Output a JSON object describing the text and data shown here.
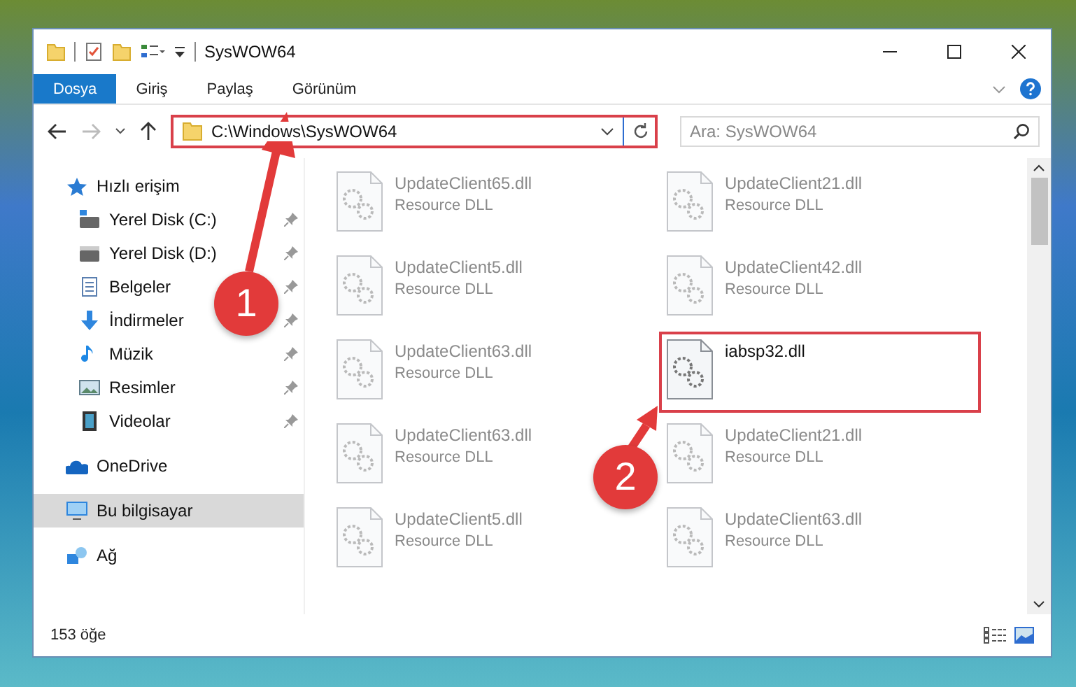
{
  "window": {
    "title": "SysWOW64"
  },
  "ribbon_tabs": [
    {
      "label": "Dosya",
      "selected": true
    },
    {
      "label": "Giriş",
      "selected": false
    },
    {
      "label": "Paylaş",
      "selected": false
    },
    {
      "label": "Görünüm",
      "selected": false
    }
  ],
  "address_bar": {
    "path": "C:\\Windows\\SysWOW64",
    "highlighted": true
  },
  "search": {
    "placeholder": "Ara: SysWOW64"
  },
  "sidebar": {
    "items": [
      {
        "kind": "quick",
        "label": "Hızlı erişim",
        "selected": false,
        "children": [
          {
            "kind": "drive-windows",
            "label": "Yerel Disk (C:)",
            "pinned": true,
            "selected": false
          },
          {
            "kind": "drive",
            "label": "Yerel Disk (D:)",
            "pinned": true,
            "selected": false
          },
          {
            "kind": "documents",
            "label": "Belgeler",
            "pinned": true,
            "selected": false
          },
          {
            "kind": "downloads",
            "label": "İndirmeler",
            "pinned": true,
            "selected": false
          },
          {
            "kind": "music",
            "label": "Müzik",
            "pinned": true,
            "selected": false
          },
          {
            "kind": "pictures",
            "label": "Resimler",
            "pinned": true,
            "selected": false
          },
          {
            "kind": "videos",
            "label": "Videolar",
            "pinned": true,
            "selected": false
          }
        ]
      },
      {
        "kind": "cloud",
        "label": "OneDrive",
        "selected": false
      },
      {
        "kind": "computer",
        "label": "Bu bilgisayar",
        "selected": true
      },
      {
        "kind": "network",
        "label": "Ağ",
        "selected": false
      }
    ]
  },
  "files": [
    {
      "name": "UpdateClient65.dll",
      "type": "Resource DLL",
      "highlighted": false
    },
    {
      "name": "UpdateClient21.dll",
      "type": "Resource DLL",
      "highlighted": false
    },
    {
      "name": "UpdateClient5.dll",
      "type": "Resource DLL",
      "highlighted": false
    },
    {
      "name": "UpdateClient42.dll",
      "type": "Resource DLL",
      "highlighted": false
    },
    {
      "name": "UpdateClient63.dll",
      "type": "Resource DLL",
      "highlighted": false
    },
    {
      "name": "iabsp32.dll",
      "highlighted": true
    },
    {
      "name": "UpdateClient63.dll",
      "type": "Resource DLL",
      "highlighted": false
    },
    {
      "name": "UpdateClient21.dll",
      "type": "Resource DLL",
      "highlighted": false
    },
    {
      "name": "UpdateClient5.dll",
      "type": "Resource DLL",
      "highlighted": false
    },
    {
      "name": "UpdateClient63.dll",
      "type": "Resource DLL",
      "highlighted": false
    }
  ],
  "status_bar": {
    "count": "153 öğe"
  },
  "callouts": [
    {
      "label": "1"
    },
    {
      "label": "2"
    }
  ]
}
